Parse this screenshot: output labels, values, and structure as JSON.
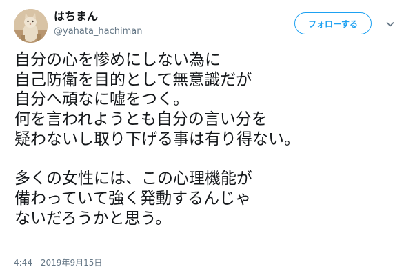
{
  "user": {
    "display_name": "はちまん",
    "handle": "@yahata_hachiman"
  },
  "follow_button": {
    "label": "フォローする"
  },
  "tweet": {
    "lines": [
      "自分の心を惨めにしない為に",
      "自己防衛を目的として無意識だが",
      "自分へ頑なに嘘をつく。",
      "何を言われようとも自分の言い分を",
      "疑わないし取り下げる事は有り得ない。",
      "",
      "多くの女性には、この心理機能が",
      "備わっていて強く発動するんじゃ",
      "ないだろうかと思う。"
    ],
    "timestamp": "4:44 - 2019年9月15日"
  },
  "colors": {
    "accent": "#1da1f2",
    "text": "#14171a",
    "muted": "#657786"
  },
  "icons": {
    "avatar": "cat-avatar",
    "menu": "chevron-down-icon"
  }
}
